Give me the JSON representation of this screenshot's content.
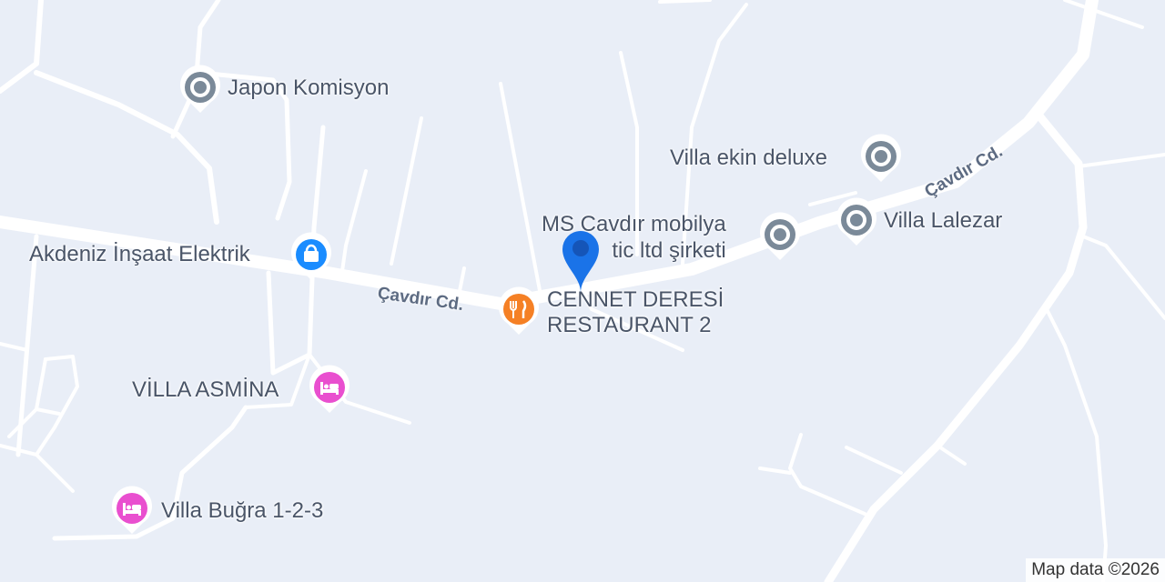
{
  "map": {
    "roads": [
      {
        "name": "Çavdır Cd."
      },
      {
        "name": "Çavdır Cd."
      }
    ],
    "pois": [
      {
        "name": "Japon Komisyon",
        "category": "place",
        "icon": "place-icon",
        "color": "#7b8a99"
      },
      {
        "name": "Akdeniz İnşaat Elektrik",
        "category": "shopping",
        "icon": "shopping-bag-icon",
        "color": "#1a8cff"
      },
      {
        "name": "CENNET DERESİ\nRESTAURANT 2",
        "category": "restaurant",
        "icon": "fork-knife-icon",
        "color": "#f58025"
      },
      {
        "name": "VİLLA ASMİNA",
        "category": "lodging",
        "icon": "bed-icon",
        "color": "#e94fcf"
      },
      {
        "name": "Villa Buğra 1-2-3",
        "category": "lodging",
        "icon": "bed-icon",
        "color": "#e94fcf"
      },
      {
        "name": "MS Cavdır mobilya\ntic ltd şirketi",
        "category": "place",
        "icon": "place-icon",
        "color": "#7b8a99"
      },
      {
        "name": "Villa ekin deluxe",
        "category": "place",
        "icon": "place-icon",
        "color": "#7b8a99"
      },
      {
        "name": "Villa Lalezar",
        "category": "place",
        "icon": "place-icon",
        "color": "#7b8a99"
      }
    ],
    "marker": {
      "icon": "location-marker-icon",
      "color": "#1a73e8"
    },
    "attribution": "Map data ©2026"
  }
}
